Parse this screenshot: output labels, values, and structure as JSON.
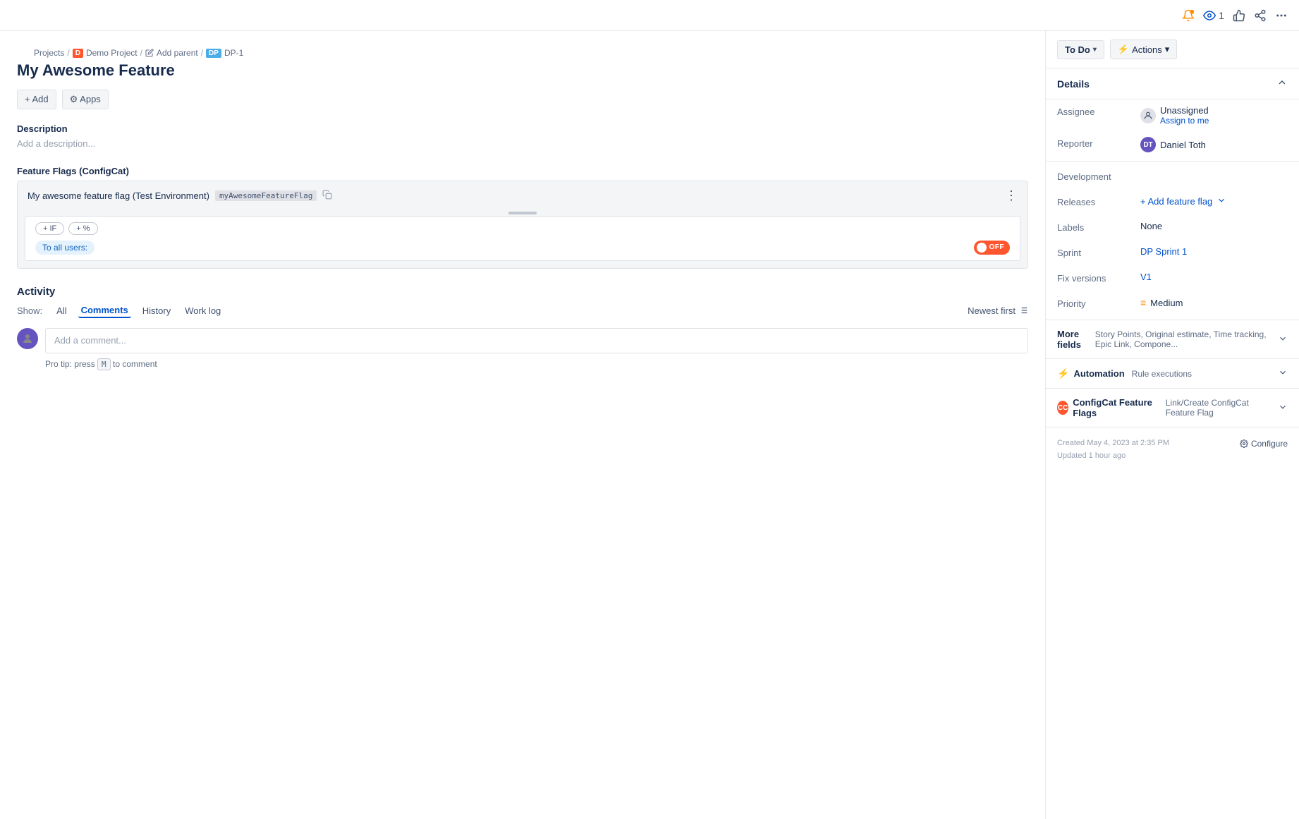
{
  "topbar": {
    "notification_icon": "bell-icon",
    "watch_count": "1",
    "like_icon": "thumbsup-icon",
    "share_icon": "share-icon",
    "more_icon": "more-icon"
  },
  "breadcrumb": {
    "projects": "Projects",
    "demo_project": "Demo Project",
    "add_parent": "Add parent",
    "ticket_id": "DP-1"
  },
  "page": {
    "title": "My Awesome Feature"
  },
  "toolbar": {
    "add_label": "+ Add",
    "apps_label": "⚙ Apps"
  },
  "description": {
    "header": "Description",
    "placeholder": "Add a description..."
  },
  "feature_flags": {
    "section_title": "Feature Flags (ConfigCat)",
    "flag_name": "My awesome feature flag (Test Environment)",
    "flag_key": "myAwesomeFeatureFlag",
    "condition_if": "+ IF",
    "condition_percent": "+ %",
    "to_all_users": "To all users:",
    "toggle_label": "OFF"
  },
  "activity": {
    "title": "Activity",
    "show_label": "Show:",
    "tabs": [
      {
        "id": "all",
        "label": "All"
      },
      {
        "id": "comments",
        "label": "Comments"
      },
      {
        "id": "history",
        "label": "History"
      },
      {
        "id": "worklog",
        "label": "Work log"
      }
    ],
    "active_tab": "comments",
    "sort_label": "Newest first",
    "comment_placeholder": "Add a comment...",
    "pro_tip": "Pro tip: press",
    "pro_tip_key": "M",
    "pro_tip_suffix": "to comment"
  },
  "sidebar": {
    "status": "To Do",
    "actions_label": "Actions",
    "details_title": "Details",
    "fields": {
      "assignee_label": "Assignee",
      "assignee_value": "Unassigned",
      "assign_me": "Assign to me",
      "reporter_label": "Reporter",
      "reporter_value": "Daniel Toth",
      "development_label": "Development",
      "releases_label": "Releases",
      "add_feature_flag": "+ Add feature flag",
      "labels_label": "Labels",
      "labels_value": "None",
      "sprint_label": "Sprint",
      "sprint_value": "DP Sprint 1",
      "fix_versions_label": "Fix versions",
      "fix_version_value": "V1",
      "priority_label": "Priority",
      "priority_value": "Medium"
    },
    "more_fields_label": "More fields",
    "more_fields_sub": "Story Points, Original estimate, Time tracking, Epic Link, Compone...",
    "automation_label": "Automation",
    "automation_sub": "Rule executions",
    "configcat_label": "ConfigCat Feature Flags",
    "configcat_sub": "Link/Create ConfigCat Feature Flag",
    "created_label": "Created May 4, 2023 at 2:35 PM",
    "updated_label": "Updated 1 hour ago",
    "configure_label": "Configure"
  }
}
